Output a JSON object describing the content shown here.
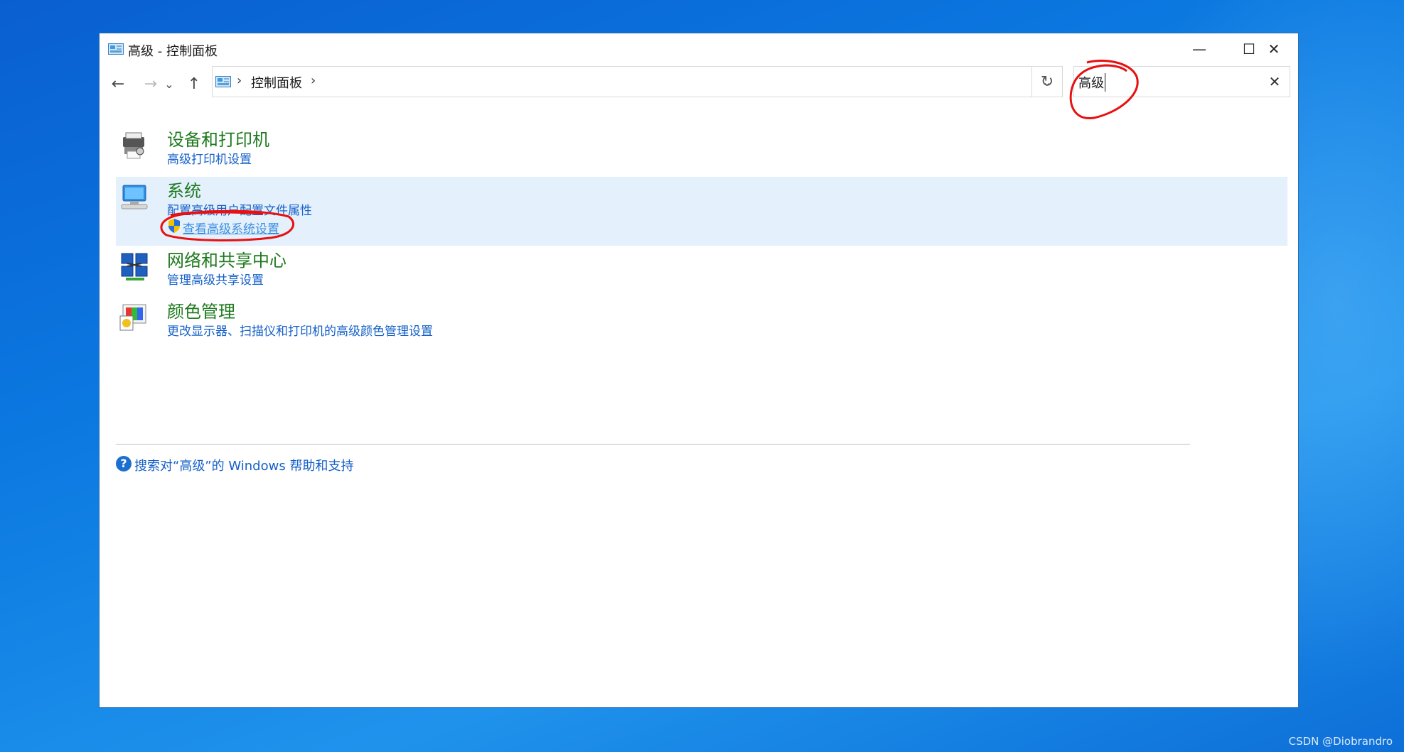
{
  "window": {
    "title": "高级 - 控制面板",
    "minimize_glyph": "—",
    "maximize_glyph": "☐",
    "close_glyph": "✕"
  },
  "nav": {
    "back_glyph": "←",
    "forward_glyph": "→",
    "recent_glyph": "⌄",
    "up_glyph": "↑",
    "separator": "›",
    "breadcrumb": "控制面板",
    "dropdown_glyph": "⌄",
    "refresh_glyph": "↻"
  },
  "search": {
    "value": "高级",
    "clear_glyph": "✕"
  },
  "results": [
    {
      "title": "设备和打印机",
      "links": [
        "高级打印机设置"
      ],
      "icon": "printer-icon"
    },
    {
      "title": "系统",
      "links": [
        "配置高级用户配置文件属性"
      ],
      "uac_link": "查看高级系统设置",
      "icon": "computer-icon"
    },
    {
      "title": "网络和共享中心",
      "links": [
        "管理高级共享设置"
      ],
      "icon": "network-icon"
    },
    {
      "title": "颜色管理",
      "links": [
        "更改显示器、扫描仪和打印机的高级颜色管理设置"
      ],
      "icon": "color-management-icon"
    }
  ],
  "help": {
    "icon_glyph": "?",
    "text": "搜索对“高级”的 Windows 帮助和支持"
  },
  "watermark": "CSDN @Diobrandro",
  "colors": {
    "title_green": "#1e7a1e",
    "link_blue": "#1560c8",
    "highlight": "#e4f0fb",
    "annotation_red": "#e81010"
  }
}
